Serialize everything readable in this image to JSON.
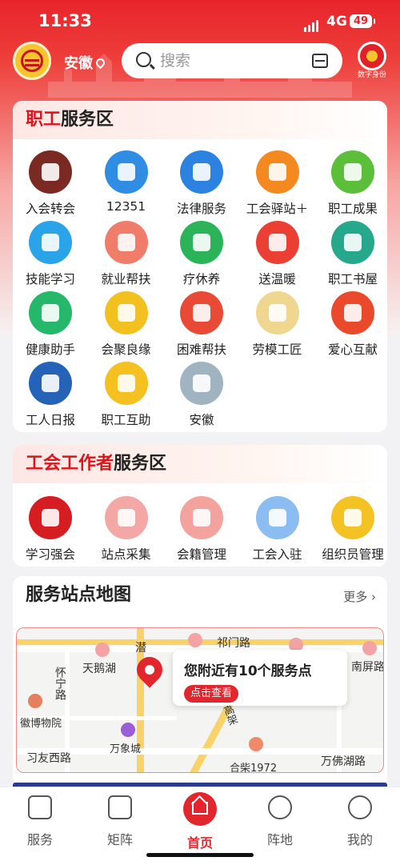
{
  "status": {
    "time": "11:33",
    "network": "4G",
    "battery": "49"
  },
  "header": {
    "region": "安徽",
    "search_placeholder": "搜索",
    "digital_id_label": "数字身份"
  },
  "worker_zone": {
    "title_accent": "职工",
    "title_rest": "服务区",
    "items": [
      {
        "label": "入会转会",
        "icon": "membership-book-icon",
        "color": "#7a2a22"
      },
      {
        "label": "12351",
        "icon": "hotline-12351-icon",
        "color": "#2f8de4"
      },
      {
        "label": "法律服务",
        "icon": "scales-icon",
        "color": "#2c82e0"
      },
      {
        "label": "工会驿站＋",
        "icon": "station-icon",
        "color": "#f48a1f"
      },
      {
        "label": "职工成果",
        "icon": "tree-icon",
        "color": "#5cbf3a"
      },
      {
        "label": "技能学习",
        "icon": "worker-helmet-icon",
        "color": "#2aa3e8"
      },
      {
        "label": "就业帮扶",
        "icon": "resume-icon",
        "color": "#f07c6a"
      },
      {
        "label": "疗休养",
        "icon": "palm-tree-icon",
        "color": "#2bb35a"
      },
      {
        "label": "送温暖",
        "icon": "heart-hand-icon",
        "color": "#ec3f34"
      },
      {
        "label": "职工书屋",
        "icon": "book-icon",
        "color": "#25a88b"
      },
      {
        "label": "健康助手",
        "icon": "nurse-icon",
        "color": "#26b86a"
      },
      {
        "label": "会聚良缘",
        "icon": "couple-icon",
        "color": "#f3c11f"
      },
      {
        "label": "困难帮扶",
        "icon": "heart-care-icon",
        "color": "#e84a36"
      },
      {
        "label": "劳模工匠",
        "icon": "medal-icon",
        "color": "#f0d78f"
      },
      {
        "label": "爱心互献",
        "icon": "heart-donate-icon",
        "color": "#ea4a2b"
      },
      {
        "label": "工人日报",
        "icon": "workers-daily-icon",
        "color": "#2463b8"
      },
      {
        "label": "职工互助",
        "icon": "union-logo-icon",
        "color": "#f4c120"
      },
      {
        "label": "安徽",
        "icon": "anhui-landscape-icon",
        "color": "#9fb3c0"
      }
    ]
  },
  "unionist_zone": {
    "title_accent": "工会工作者",
    "title_rest": "服务区",
    "items": [
      {
        "label": "学习强会",
        "icon": "study-icon",
        "color": "#d61d22"
      },
      {
        "label": "站点采集",
        "icon": "map-pin-icon",
        "color": "#f4a8a6"
      },
      {
        "label": "会籍管理",
        "icon": "member-admin-icon",
        "color": "#f3a29d"
      },
      {
        "label": "工会入驻",
        "icon": "document-icon",
        "color": "#8bbcf2"
      },
      {
        "label": "组织员管理",
        "icon": "id-card-icon",
        "color": "#f5c224"
      }
    ]
  },
  "map_card": {
    "title": "服务站点地图",
    "more_label": "更多 ›",
    "popup_text": "您附近有10个服务点",
    "popup_button": "点击查看",
    "labels": [
      "祁门路",
      "天鹅湖",
      "南屏路",
      "怀宁路",
      "徽博物院",
      "万象城",
      "习友西路",
      "合柴1972",
      "万佛湖路",
      "潜",
      "高架"
    ]
  },
  "bottom_nav": [
    {
      "label": "服务",
      "icon": "service-hand-icon"
    },
    {
      "label": "矩阵",
      "icon": "building-icon"
    },
    {
      "label": "首页",
      "icon": "home-icon"
    },
    {
      "label": "阵地",
      "icon": "location-icon"
    },
    {
      "label": "我的",
      "icon": "profile-icon"
    }
  ]
}
